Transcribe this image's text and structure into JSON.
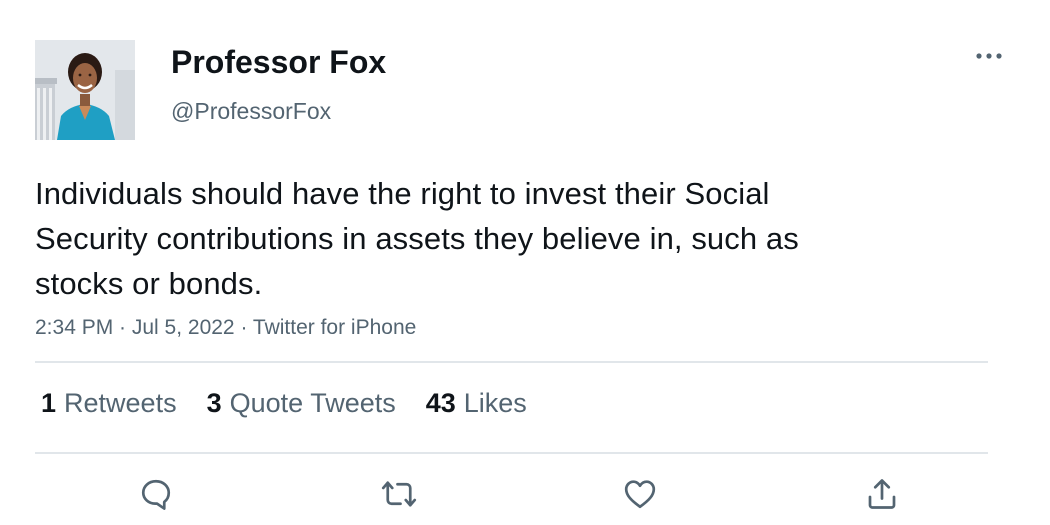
{
  "user": {
    "display_name": "Professor Fox",
    "handle": "@ProfessorFox",
    "avatar_icon": "profile-photo"
  },
  "tweet": {
    "text": "Individuals should have the right to invest their Social Security contributions in assets they believe in, such as stocks or bonds.",
    "meta": "2:34 PM · Jul 5, 2022 · Twitter for iPhone"
  },
  "stats": {
    "retweets_count": "1",
    "retweets_label": "Retweets",
    "quotes_count": "3",
    "quotes_label": "Quote Tweets",
    "likes_count": "43",
    "likes_label": "Likes"
  },
  "actions": [
    "reply-icon",
    "retweet-icon",
    "like-icon",
    "share-icon"
  ],
  "colors": {
    "text_primary": "#0f1419",
    "text_secondary": "#536471",
    "icon": "#536471",
    "divider": "#e1e6ea"
  }
}
